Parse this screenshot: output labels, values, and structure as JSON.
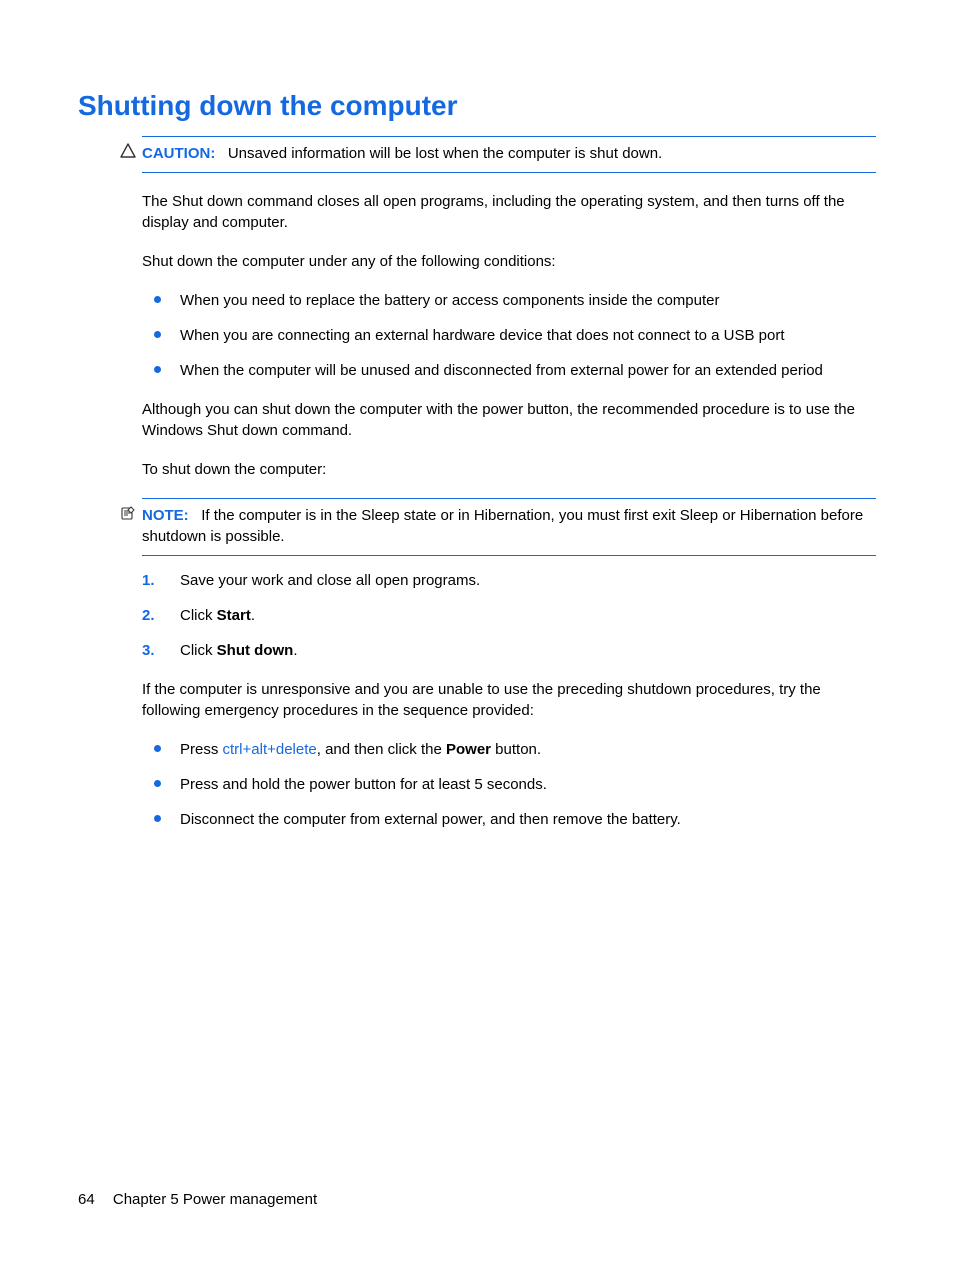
{
  "title": "Shutting down the computer",
  "caution": {
    "label": "CAUTION:",
    "text": "Unsaved information will be lost when the computer is shut down."
  },
  "para1": "The Shut down command closes all open programs, including the operating system, and then turns off the display and computer.",
  "para2": "Shut down the computer under any of the following conditions:",
  "conditions": [
    "When you need to replace the battery or access components inside the computer",
    "When you are connecting an external hardware device that does not connect to a USB port",
    "When the computer will be unused and disconnected from external power for an extended period"
  ],
  "para3": "Although you can shut down the computer with the power button, the recommended procedure is to use the Windows Shut down command.",
  "para4": "To shut down the computer:",
  "note": {
    "label": "NOTE:",
    "text": "If the computer is in the Sleep state or in Hibernation, you must first exit Sleep or Hibernation before shutdown is possible."
  },
  "steps": [
    {
      "num": "1.",
      "pre": "Save your work and close all open programs.",
      "bold": "",
      "post": ""
    },
    {
      "num": "2.",
      "pre": "Click ",
      "bold": "Start",
      "post": "."
    },
    {
      "num": "3.",
      "pre": "Click ",
      "bold": "Shut down",
      "post": "."
    }
  ],
  "para5": "If the computer is unresponsive and you are unable to use the preceding shutdown procedures, try the following emergency procedures in the sequence provided:",
  "emergency": [
    {
      "pre": "Press ",
      "key": "ctrl+alt+delete",
      "mid": ", and then click the ",
      "bold": "Power",
      "post": " button."
    },
    {
      "pre": "Press and hold the power button for at least 5 seconds.",
      "key": "",
      "mid": "",
      "bold": "",
      "post": ""
    },
    {
      "pre": "Disconnect the computer from external power, and then remove the battery.",
      "key": "",
      "mid": "",
      "bold": "",
      "post": ""
    }
  ],
  "footer": {
    "page": "64",
    "chapter": "Chapter 5   Power management"
  }
}
